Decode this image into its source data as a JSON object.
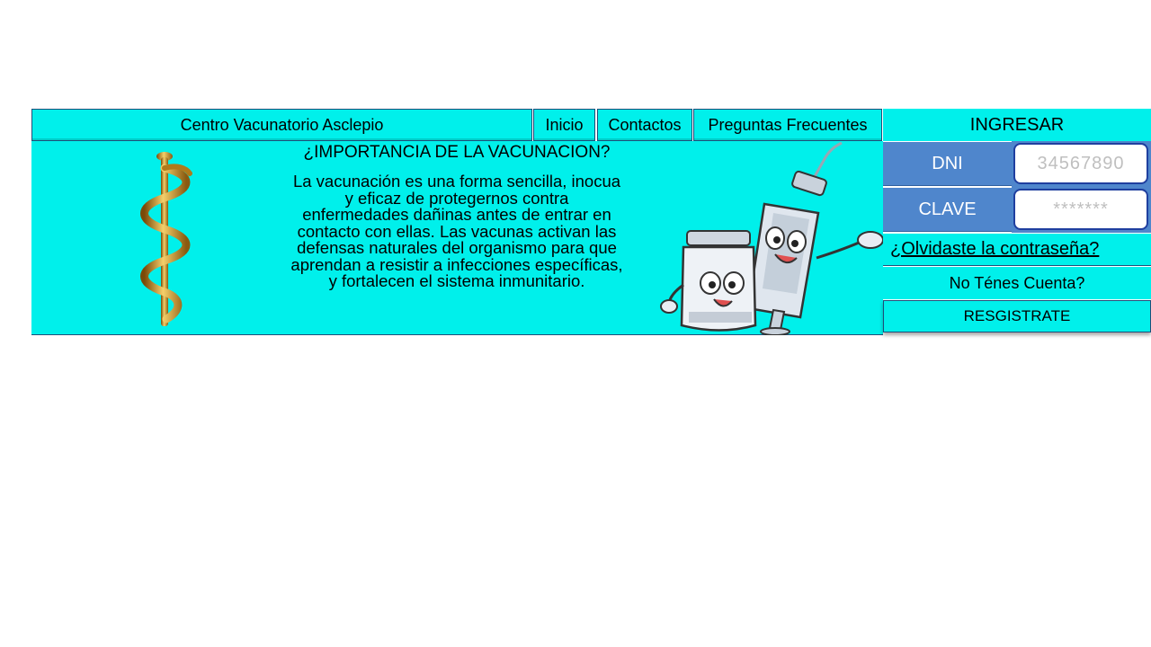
{
  "nav": {
    "brand": "Centro Vacunatorio  Asclepio",
    "inicio": "Inicio",
    "contactos": "Contactos",
    "faq": "Preguntas Frecuentes"
  },
  "info": {
    "title": "¿IMPORTANCIA DE LA VACUNACION?",
    "body": "La vacunación es una forma sencilla, inocua y eficaz de protegernos contra enfermedades dañinas antes de entrar en contacto con ellas.  Las vacunas activan las defensas naturales del organismo para que aprendan a resistir a infecciones específicas, y fortalecen el sistema inmunitario."
  },
  "login": {
    "title": "INGRESAR",
    "dni_label": "DNI",
    "dni_placeholder": "34567890",
    "clave_label": "CLAVE",
    "clave_placeholder": "*******",
    "forgot": "¿Olvidaste la contraseña?",
    "no_account": "No Ténes Cuenta?",
    "register": "RESGISTRATE"
  },
  "icons": {
    "staff": "rod-of-asclepius-icon",
    "mascots": "vaccine-mascots-icon"
  },
  "colors": {
    "cyan": "#00f0eb",
    "blue": "#4f86cc",
    "border": "#1f4e79"
  }
}
